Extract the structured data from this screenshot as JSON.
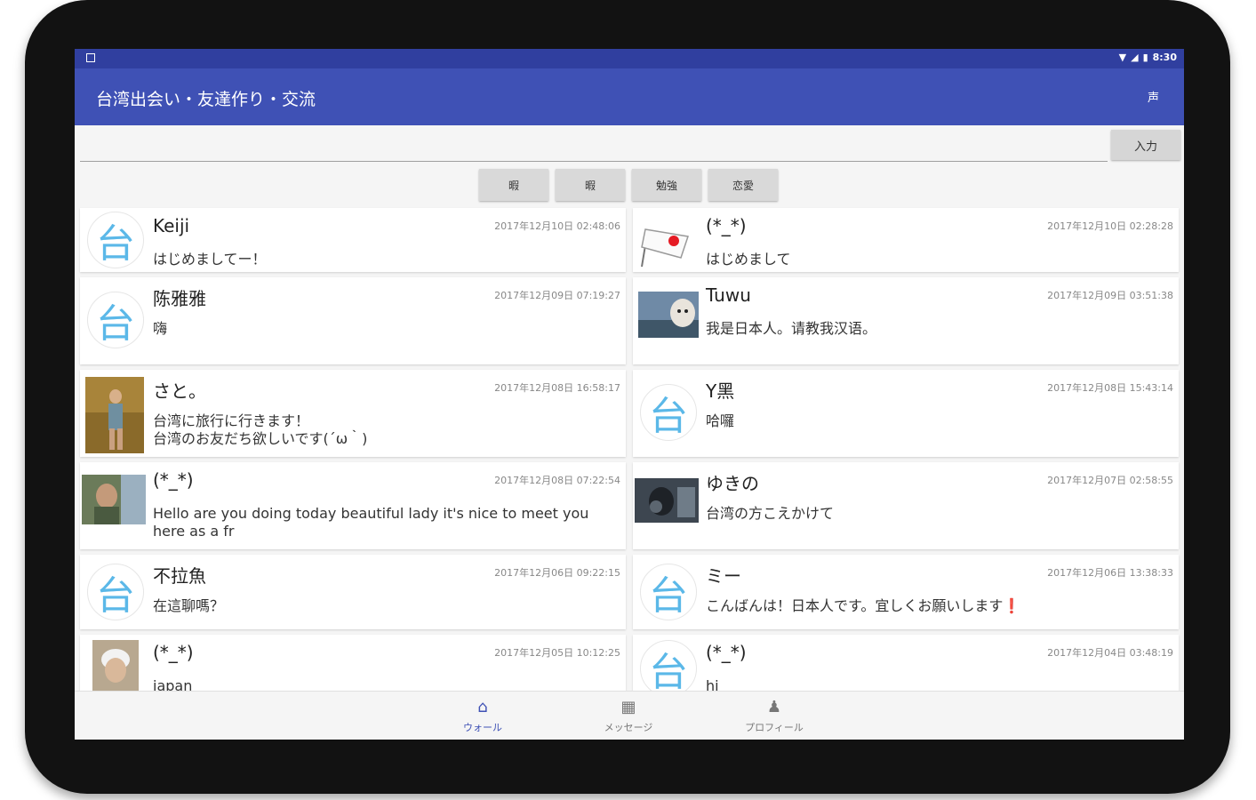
{
  "app": {
    "title": "台湾出会い・友達作り・交流",
    "action_label": "声"
  },
  "status": {
    "time": "8:30"
  },
  "input": {
    "placeholder": "",
    "button_label": "入力"
  },
  "chips": [
    "暇",
    "暇",
    "勉強",
    "恋愛"
  ],
  "posts": [
    {
      "name": "Keiji",
      "time": "2017年12月10日 02:48:06",
      "message": "はじめましてー！",
      "avatar": "台"
    },
    {
      "name": "(*_*)",
      "time": "2017年12月10日 02:28:28",
      "message": "はじめまして",
      "avatar": "flag"
    },
    {
      "name": "陈雅雅",
      "time": "2017年12月09日 07:19:27",
      "message": "嗨",
      "avatar": "台"
    },
    {
      "name": "Tuwu",
      "time": "2017年12月09日 03:51:38",
      "message": "我是日本人。请教我汉语。",
      "avatar": "photo"
    },
    {
      "name": "さと。",
      "time": "2017年12月08日 16:58:17",
      "message": "台湾に旅行に行きます！\n台湾のお友だち欲しいです(´ω｀)",
      "avatar": "photo"
    },
    {
      "name": "Y黑",
      "time": "2017年12月08日 15:43:14",
      "message": "哈囉",
      "avatar": "台"
    },
    {
      "name": "(*_*)",
      "time": "2017年12月08日 07:22:54",
      "message": "Hello are you doing today beautiful lady it's nice to meet you here as a fr",
      "avatar": "photo"
    },
    {
      "name": "ゆきの",
      "time": "2017年12月07日 02:58:55",
      "message": "台湾の方こえかけて",
      "avatar": "photo"
    },
    {
      "name": "不拉魚",
      "time": "2017年12月06日 09:22:15",
      "message": "在這聊嗎？",
      "avatar": "台"
    },
    {
      "name": "ミー",
      "time": "2017年12月06日 13:38:33",
      "message": "こんばんは！日本人です。宜しくお願いします❗",
      "avatar": "台"
    },
    {
      "name": "(*_*)",
      "time": "2017年12月05日 10:12:25",
      "message": "japan",
      "avatar": "photo"
    },
    {
      "name": "(*_*)",
      "time": "2017年12月04日 03:48:19",
      "message": "hi",
      "avatar": "台"
    }
  ],
  "nav": [
    {
      "label": "ウォール",
      "icon": "home-icon",
      "active": true
    },
    {
      "label": "メッセージ",
      "icon": "grid-icon",
      "active": false
    },
    {
      "label": "プロフィール",
      "icon": "person-icon",
      "active": false
    }
  ],
  "colors": {
    "primary": "#3f51b5",
    "primary_dark": "#303f9f",
    "accent_avatar": "#5bb8e8"
  }
}
